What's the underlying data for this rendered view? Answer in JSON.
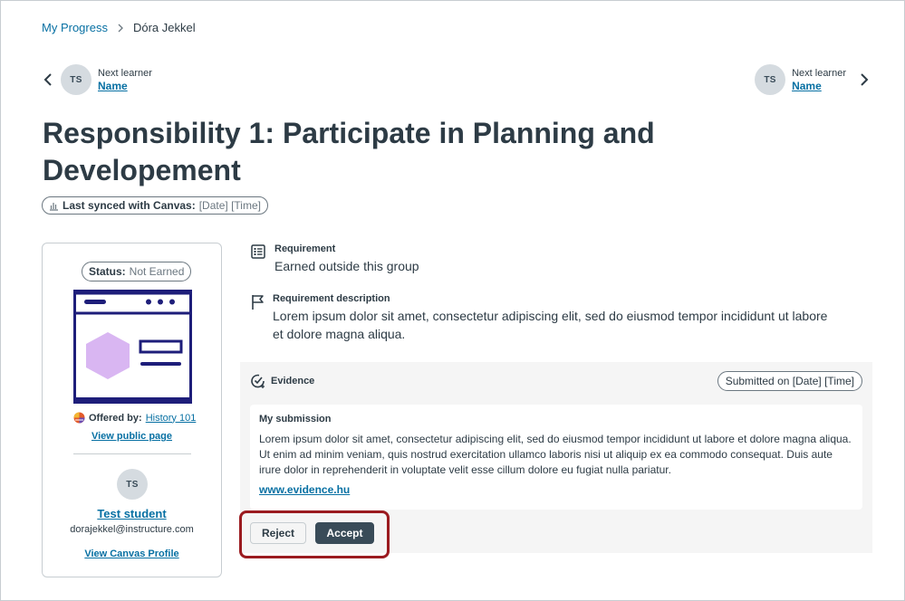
{
  "breadcrumb": {
    "parent": "My Progress",
    "current": "Dóra Jekkel"
  },
  "prev_learner": {
    "initials": "TS",
    "label": "Next learner",
    "name": "Name"
  },
  "next_learner": {
    "initials": "TS",
    "label": "Next learner",
    "name": "Name"
  },
  "page": {
    "title": "Responsibility 1: Participate in Planning and Developement"
  },
  "sync": {
    "label": "Last synced with Canvas:",
    "value": "[Date] [Time]"
  },
  "card": {
    "status_label": "Status:",
    "status_value": "Not Earned",
    "offered_label": "Offered by:",
    "offered_value": "History 101",
    "view_public": "View public page",
    "student_initials": "TS",
    "student_name": "Test student",
    "student_email": "dorajekkel@instructure.com",
    "view_profile": "View Canvas Profile"
  },
  "requirement": {
    "label": "Requirement",
    "text": "Earned outside this group"
  },
  "requirement_description": {
    "label": "Requirement description",
    "text": "Lorem ipsum dolor sit amet, consectetur adipiscing elit, sed do eiusmod tempor incididunt ut labore et dolore magna aliqua."
  },
  "evidence": {
    "label": "Evidence",
    "submitted": "Submitted on [Date] [Time]",
    "submission_heading": "My submission",
    "submission_text": "Lorem ipsum dolor sit amet, consectetur adipiscing elit, sed do eiusmod tempor incididunt ut labore et dolore magna aliqua. Ut enim ad minim veniam, quis nostrud exercitation ullamco laboris nisi ut aliquip ex ea commodo consequat. Duis aute irure dolor in reprehenderit in voluptate velit esse cillum dolore eu fugiat nulla pariatur.",
    "link": "www.evidence.hu"
  },
  "actions": {
    "reject": "Reject",
    "accept": "Accept"
  },
  "colors": {
    "link": "#0770a3",
    "text": "#2d3b45",
    "accept_bg": "#394b58",
    "highlight": "#9b1b20",
    "badge_frame": "#1e1e7a",
    "badge_hex": "#d9b6f2"
  },
  "icons": {
    "prev": "chevron-left-icon",
    "next": "chevron-right-icon",
    "sync": "sync-chart-icon",
    "requirement": "list-icon",
    "description": "flag-icon",
    "evidence": "check-circle-icon",
    "offered": "globe-icon"
  }
}
